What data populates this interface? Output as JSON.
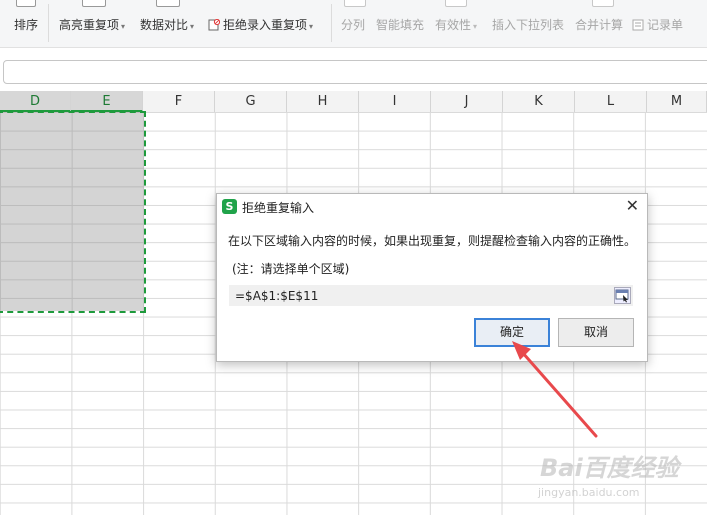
{
  "ribbon": {
    "sort": "排序",
    "highlight_dup": "高亮重复项",
    "data_compare": "数据对比",
    "reject_dup": "拒绝录入重复项",
    "split": "分列",
    "smart_fill": "智能填充",
    "validity": "有效性",
    "insert_dropdown": "插入下拉列表",
    "consolidate": "合并计算",
    "record_sheet": "记录单"
  },
  "columns": [
    "D",
    "E",
    "F",
    "G",
    "H",
    "I",
    "J",
    "K",
    "L",
    "M"
  ],
  "selected_columns": [
    "D",
    "E"
  ],
  "dialog": {
    "title": "拒绝重复输入",
    "message": "在以下区域输入内容的时候，如果出现重复，则提醒检查输入内容的正确性。",
    "note": "(注：请选择单个区域)",
    "range_value": "=$A$1:$E$11",
    "ok": "确定",
    "cancel": "取消",
    "close_icon": "close-icon",
    "app_icon": "S"
  },
  "colors": {
    "selection_border": "#1e9a3c",
    "ok_border": "#3b82d8",
    "arrow": "#e8494c"
  },
  "watermark": {
    "logo": "Bai百度经验",
    "url": "jingyan.baidu.com"
  }
}
